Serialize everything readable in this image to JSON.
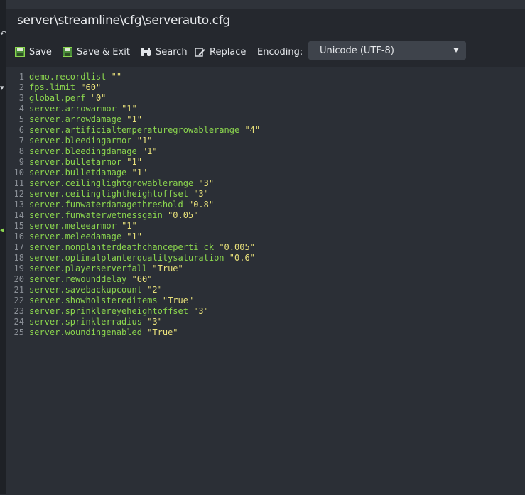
{
  "window": {
    "title": "server\\streamline\\cfg\\serverauto.cfg"
  },
  "toolbar": {
    "save_label": "Save",
    "save_exit_label": "Save & Exit",
    "search_label": "Search",
    "replace_label": "Replace",
    "encoding_label": "Encoding:",
    "encoding_value": "Unicode (UTF-8)"
  },
  "icons": {
    "save": "floppy-disk-icon",
    "save_exit": "floppy-disk-icon",
    "search": "binoculars-icon",
    "replace": "edit-pencil-icon",
    "encoding_dropdown": "caret-down-icon"
  },
  "colors": {
    "key": "#8bd64e",
    "value": "#e8e07a",
    "line_number": "#8b9097",
    "background": "#2b2f36"
  },
  "editor": {
    "lines": [
      {
        "num": "1",
        "key": "demo.recordlist",
        "value": "\"\""
      },
      {
        "num": "2",
        "key": "fps.limit",
        "value": "\"60\""
      },
      {
        "num": "3",
        "key": "global.perf",
        "value": "\"0\""
      },
      {
        "num": "4",
        "key": "server.arrowarmor",
        "value": "\"1\""
      },
      {
        "num": "5",
        "key": "server.arrowdamage",
        "value": "\"1\""
      },
      {
        "num": "6",
        "key": "server.artificialtemperaturegrowablerange",
        "value": "\"4\""
      },
      {
        "num": "7",
        "key": "server.bleedingarmor",
        "value": "\"1\""
      },
      {
        "num": "8",
        "key": "server.bleedingdamage",
        "value": "\"1\""
      },
      {
        "num": "9",
        "key": "server.bulletarmor",
        "value": "\"1\""
      },
      {
        "num": "10",
        "key": "server.bulletdamage",
        "value": "\"1\""
      },
      {
        "num": "11",
        "key": "server.ceilinglightgrowablerange",
        "value": "\"3\""
      },
      {
        "num": "12",
        "key": "server.ceilinglightheightoffset",
        "value": "\"3\""
      },
      {
        "num": "13",
        "key": "server.funwaterdamagethreshold",
        "value": "\"0.8\""
      },
      {
        "num": "14",
        "key": "server.funwaterwetnessgain",
        "value": "\"0.05\""
      },
      {
        "num": "15",
        "key": "server.meleearmor",
        "value": "\"1\""
      },
      {
        "num": "16",
        "key": "server.meleedamage",
        "value": "\"1\""
      },
      {
        "num": "17",
        "key": "server.nonplanterdeathchanceperti ck",
        "value": "\"0.005\""
      },
      {
        "num": "18",
        "key": "server.optimalplanterqualitysaturation",
        "value": "\"0.6\""
      },
      {
        "num": "19",
        "key": "server.playerserverfall",
        "value": "\"True\""
      },
      {
        "num": "20",
        "key": "server.rewounddelay",
        "value": "\"60\""
      },
      {
        "num": "21",
        "key": "server.savebackupcount",
        "value": "\"2\""
      },
      {
        "num": "22",
        "key": "server.showholstereditems",
        "value": "\"True\""
      },
      {
        "num": "23",
        "key": "server.sprinklereyeheightoffset",
        "value": "\"3\""
      },
      {
        "num": "24",
        "key": "server.sprinklerradius",
        "value": "\"3\""
      },
      {
        "num": "25",
        "key": "server.woundingenabled",
        "value": "\"True\""
      }
    ]
  }
}
